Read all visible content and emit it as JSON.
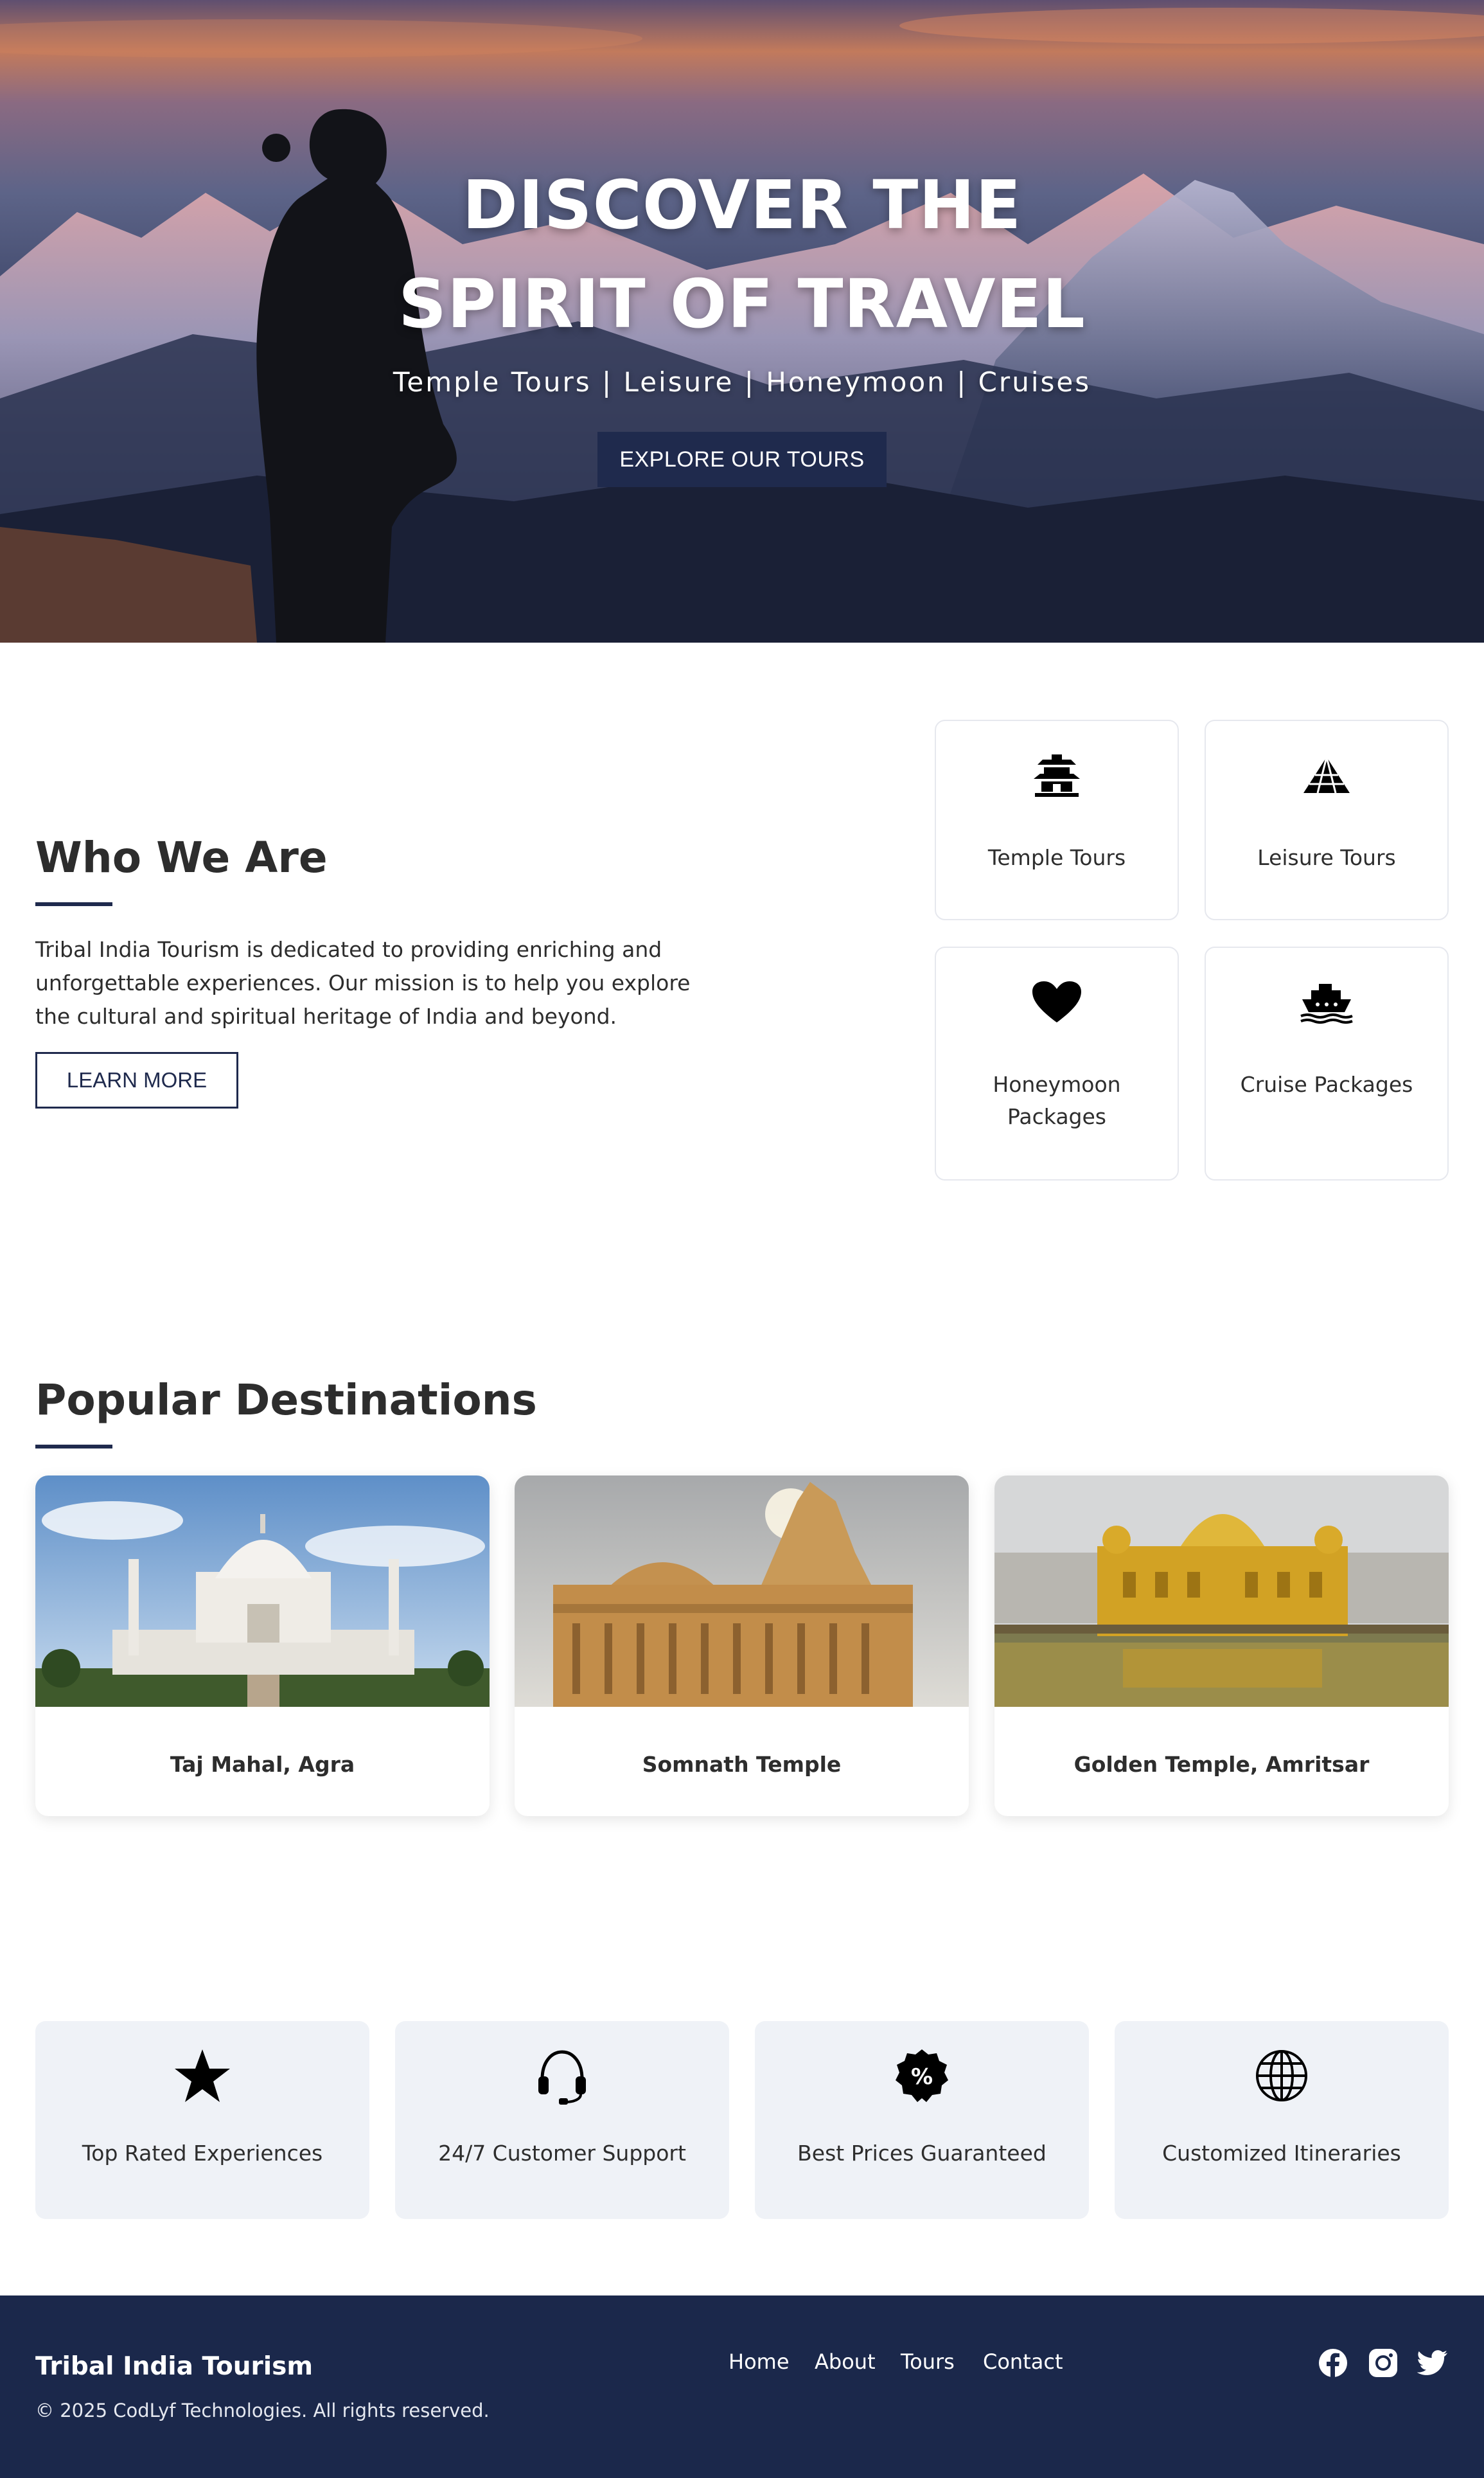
{
  "hero": {
    "title_line1": "DISCOVER THE",
    "title_line2": "SPIRIT OF TRAVEL",
    "subtitle": "Temple Tours | Leisure | Honeymoon | Cruises",
    "cta_label": "EXPLORE OUR TOURS"
  },
  "about": {
    "title": "Who We Are",
    "text": "Tribal India Tourism is dedicated to providing enriching and unforgettable experiences. Our mission is to help you explore the cultural and spiritual heritage of India and beyond.",
    "button_label": "LEARN MORE"
  },
  "services": [
    {
      "label": "Temple Tours",
      "icon": "pagoda-icon"
    },
    {
      "label": "Leisure Tours",
      "icon": "pyramid-icon"
    },
    {
      "label": "Honeymoon Packages",
      "icon": "heart-icon"
    },
    {
      "label": "Cruise Packages",
      "icon": "ship-icon"
    }
  ],
  "destinations": {
    "title": "Popular Destinations",
    "items": [
      {
        "name": "Taj Mahal, Agra"
      },
      {
        "name": "Somnath Temple"
      },
      {
        "name": "Golden Temple, Amritsar"
      }
    ]
  },
  "features": [
    {
      "label": "Top Rated Experiences",
      "icon": "star-icon"
    },
    {
      "label": "24/7 Customer Support",
      "icon": "headset-icon"
    },
    {
      "label": "Best Prices Guaranteed",
      "icon": "percent-badge-icon"
    },
    {
      "label": "Customized Itineraries",
      "icon": "globe-icon"
    }
  ],
  "footer": {
    "brand": "Tribal India Tourism",
    "copyright": "© 2025 CodLyf Technologies. All rights reserved.",
    "nav": [
      "Home",
      "About",
      "Tours",
      "Contact"
    ],
    "social": [
      "facebook-icon",
      "instagram-icon",
      "twitter-icon"
    ]
  },
  "colors": {
    "primary": "#1f2a4d",
    "footer_bg": "#1b284b",
    "feature_bg": "#eff2f7"
  }
}
